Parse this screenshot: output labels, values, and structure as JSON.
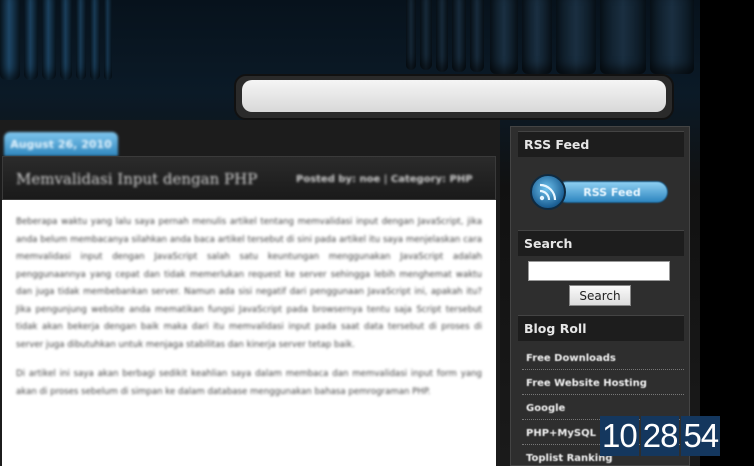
{
  "post": {
    "date": "August 26, 2010",
    "title": "Memvalidasi Input dengan PHP",
    "meta": "Posted by: noe  |  Category: PHP",
    "paragraphs": [
      "Beberapa waktu yang lalu saya pernah menulis artikel tentang memvalidasi input dengan JavaScript, jika anda belum membacanya silahkan anda baca artikel tersebut di sini pada artikel itu saya menjelaskan cara memvalidasi input dengan JavaScript salah satu keuntungan menggunakan JavaScript adalah penggunaannya yang cepat dan tidak memerlukan request ke server sehingga lebih menghemat waktu dan juga tidak membebankan server. Namun ada sisi negatif dari penggunaan JavaScript ini, apakah itu? Jika pengunjung website anda mematikan fungsi JavaScript pada browsernya tentu saja Script tersebut tidak akan bekerja dengan baik maka dari itu memvalidasi input pada saat data tersebut di proses di server juga dibutuhkan untuk menjaga stabilitas dan kinerja server tetap baik.",
      "Di artikel ini saya akan berbagi sedikit keahlian saya dalam membaca dan memvalidasi input form yang akan di proses sebelum di simpan ke dalam database menggunakan bahasa pemrograman PHP."
    ]
  },
  "sidebar": {
    "rss_heading": "RSS Feed",
    "rss_button": "RSS Feed",
    "search_heading": "Search",
    "search_value": "",
    "search_button": "Search",
    "blogroll_heading": "Blog Roll",
    "blogroll": [
      "Free Downloads",
      "Free Website Hosting",
      "Google",
      "PHP+MySQL",
      "Toplist Ranking"
    ]
  },
  "counter": {
    "groups": [
      "10",
      "28",
      "54"
    ]
  },
  "colors": {
    "accent": "#2f86bd",
    "counter_bg": "#14375e"
  }
}
